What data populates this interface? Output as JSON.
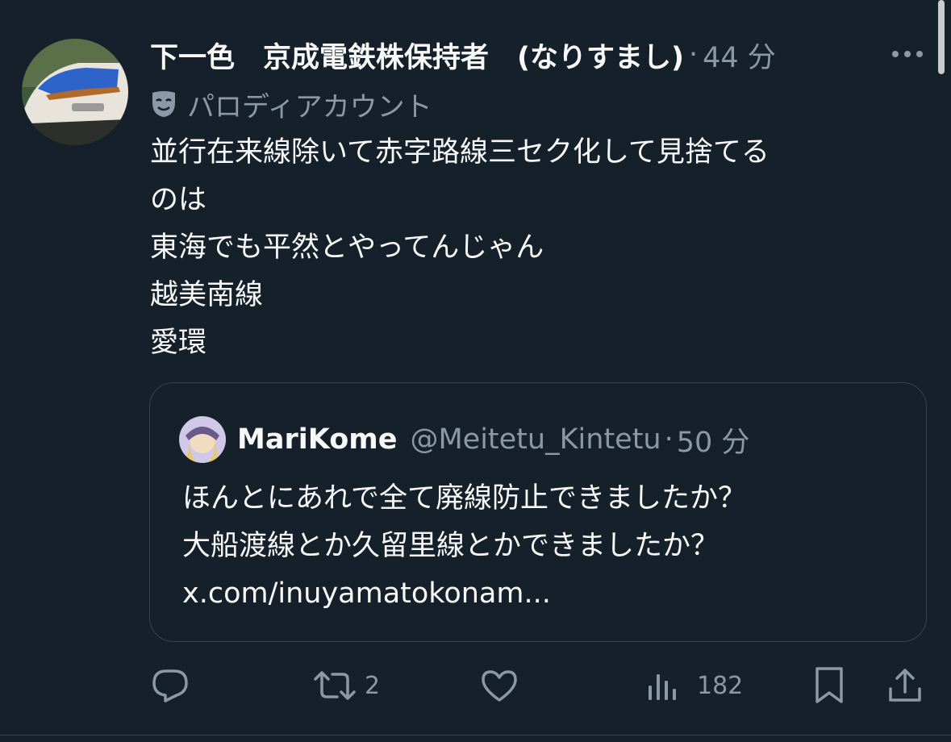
{
  "tweet": {
    "display_name": "下一色　京成電鉄株保持者　(なりすまし)",
    "separator": "·",
    "time": "44 分",
    "parody_label": "パロディアカウント",
    "text_lines": [
      "並行在来線除いて赤字路線三セク化して見捨てる",
      "のは",
      "東海でも平然とやってんじゃん",
      "越美南線",
      "愛環"
    ]
  },
  "quote": {
    "name": "MariKome",
    "handle": "@Meitetu_Kintetu",
    "separator": "·",
    "time": "50 分",
    "text_lines": [
      "ほんとにあれで全て廃線防止できましたか？",
      "大船渡線とか久留里線とかできましたか？",
      "x.com/inuyamatokonam..."
    ]
  },
  "actions": {
    "retweet_count": "2",
    "views_count": "182"
  },
  "icons": {
    "more": "more-icon",
    "parody": "mask-icon",
    "reply": "reply-icon",
    "retweet": "retweet-icon",
    "like": "heart-icon",
    "views": "views-icon",
    "bookmark": "bookmark-icon",
    "share": "share-icon"
  },
  "colors": {
    "background": "#15202b",
    "text_primary": "#f7f9f9",
    "text_secondary": "#8b98a5",
    "border": "#38444d"
  }
}
